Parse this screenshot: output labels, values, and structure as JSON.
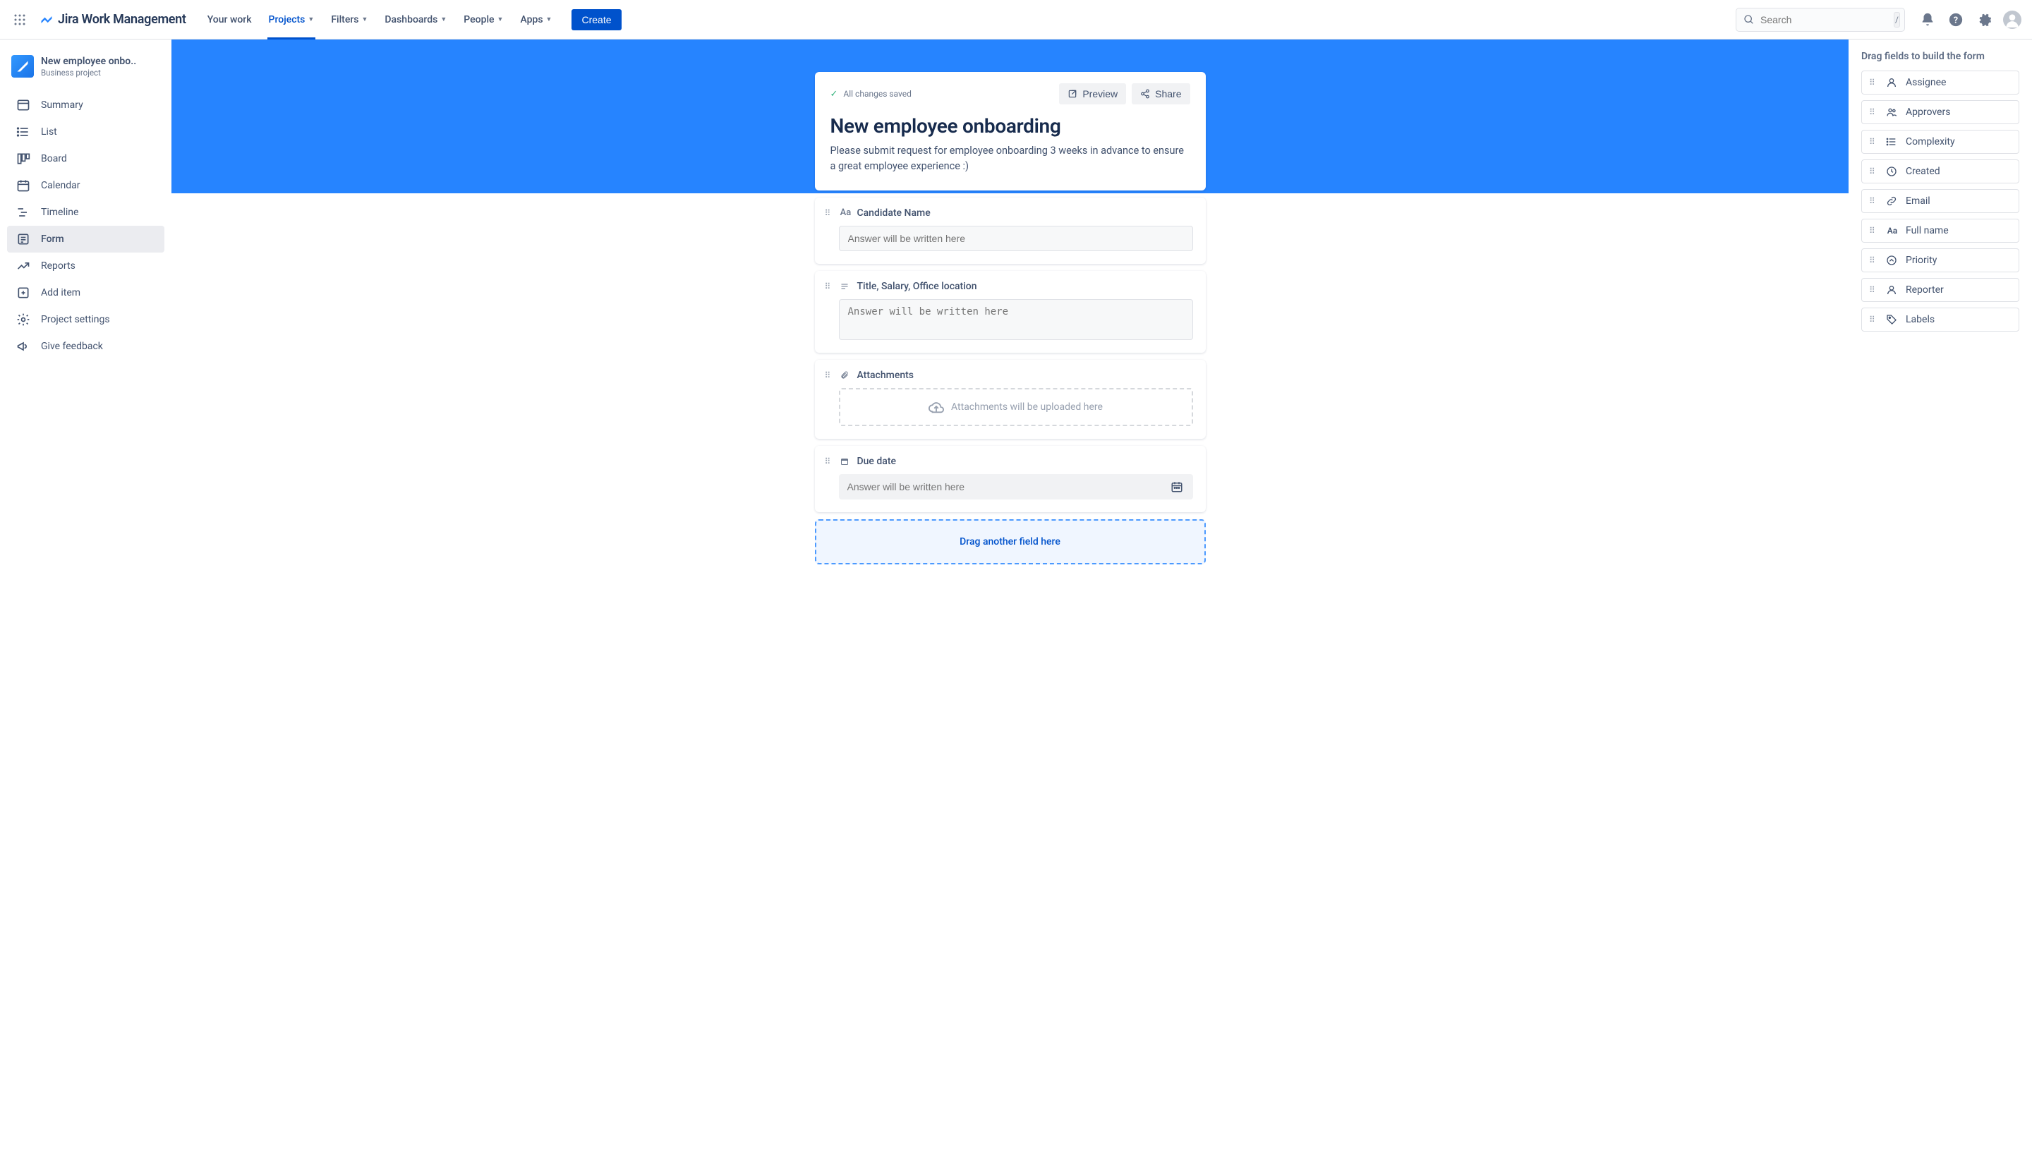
{
  "topbar": {
    "product": "Jira Work Management",
    "nav": [
      "Your work",
      "Projects",
      "Filters",
      "Dashboards",
      "People",
      "Apps"
    ],
    "nav_active_index": 1,
    "create_label": "Create",
    "search_placeholder": "Search",
    "search_shortcut": "/"
  },
  "sidebar": {
    "project_title": "New employee onbo..",
    "project_subtitle": "Business project",
    "items": [
      "Summary",
      "List",
      "Board",
      "Calendar",
      "Timeline",
      "Form",
      "Reports",
      "Add item",
      "Project settings",
      "Give feedback"
    ],
    "active_index": 5
  },
  "form": {
    "saved_text": "All changes saved",
    "preview_label": "Preview",
    "share_label": "Share",
    "title": "New employee onboarding",
    "description": "Please submit request for employee onboarding 3 weeks in advance to ensure a great employee experience :)",
    "fields": [
      {
        "label": "Candidate Name",
        "type": "text",
        "placeholder": "Answer will be written here"
      },
      {
        "label": "Title, Salary, Office location",
        "type": "paragraph",
        "placeholder": "Answer will be written here"
      },
      {
        "label": "Attachments",
        "type": "attachment",
        "placeholder": "Attachments will be uploaded here"
      },
      {
        "label": "Due date",
        "type": "date",
        "placeholder": "Answer will be written here"
      }
    ],
    "drop_text": "Drag another field here"
  },
  "right_panel": {
    "title": "Drag fields to build the form",
    "fields": [
      "Assignee",
      "Approvers",
      "Complexity",
      "Created",
      "Email",
      "Full name",
      "Priority",
      "Reporter",
      "Labels"
    ]
  }
}
